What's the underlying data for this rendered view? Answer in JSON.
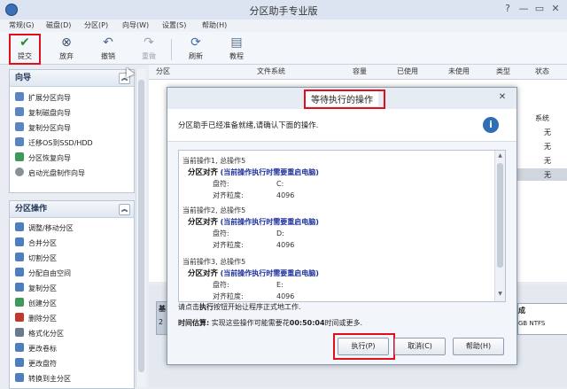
{
  "window": {
    "title": "分区助手专业版",
    "controls": [
      "?",
      "—",
      "▭",
      "✕"
    ]
  },
  "menu": [
    "常规(G)",
    "磁盘(D)",
    "分区(P)",
    "向导(W)",
    "设置(S)",
    "帮助(H)"
  ],
  "toolbar": {
    "commit": "提交",
    "discard": "放弃",
    "undo": "撤销",
    "redo": "重做",
    "refresh": "刷新",
    "tutorial": "教程"
  },
  "wizard_panel": {
    "title": "向导",
    "items": [
      "扩展分区向导",
      "复制磁盘向导",
      "复制分区向导",
      "迁移OS到SSD/HDD",
      "分区恢复向导",
      "启动光盘制作向导"
    ]
  },
  "partition_panel": {
    "title": "分区操作",
    "items": [
      "调整/移动分区",
      "合并分区",
      "切割分区",
      "分配自由空间",
      "复制分区",
      "创建分区",
      "删除分区",
      "格式化分区",
      "更改卷标",
      "更改盘符",
      "转换到主分区"
    ]
  },
  "table": {
    "columns": [
      "分区",
      "文件系统",
      "容量",
      "已使用",
      "未使用",
      "类型",
      "状态"
    ],
    "status_values": [
      "系统",
      "无",
      "无",
      "无",
      "无"
    ]
  },
  "disk_area": {
    "left_fragments": [
      "基",
      "2"
    ],
    "right_fragments": [
      "成",
      "GB NTFS"
    ]
  },
  "dialog": {
    "title": "等待执行的操作",
    "intro": "分区助手已经准备就绪,请确认下面的操作.",
    "operations": [
      {
        "header": "当前操作1, 总操作5",
        "name": "分区对齐",
        "note": "(当前操作执行时需要重启电脑)",
        "drive_label": "盘符:",
        "drive": "C:",
        "gran_label": "对齐粒度:",
        "gran": "4096"
      },
      {
        "header": "当前操作2, 总操作5",
        "name": "分区对齐",
        "note": "(当前操作执行时需要重启电脑)",
        "drive_label": "盘符:",
        "drive": "D:",
        "gran_label": "对齐粒度:",
        "gran": "4096"
      },
      {
        "header": "当前操作3, 总操作5",
        "name": "分区对齐",
        "note": "(当前操作执行时需要重启电脑)",
        "drive_label": "盘符:",
        "drive": "E:",
        "gran_label": "对齐粒度:",
        "gran": "4096"
      }
    ],
    "hint_prefix": "请点击",
    "hint_bold": "执行",
    "hint_suffix": "按钮开始让程序正式地工作.",
    "time_label": "时间估算:",
    "time_prefix": "实现这些操作可能需要花",
    "time_value": "00:50:04",
    "time_suffix": "时间或更多.",
    "buttons": {
      "execute": "执行(P)",
      "cancel": "取消(C)",
      "help": "帮助(H)"
    }
  }
}
